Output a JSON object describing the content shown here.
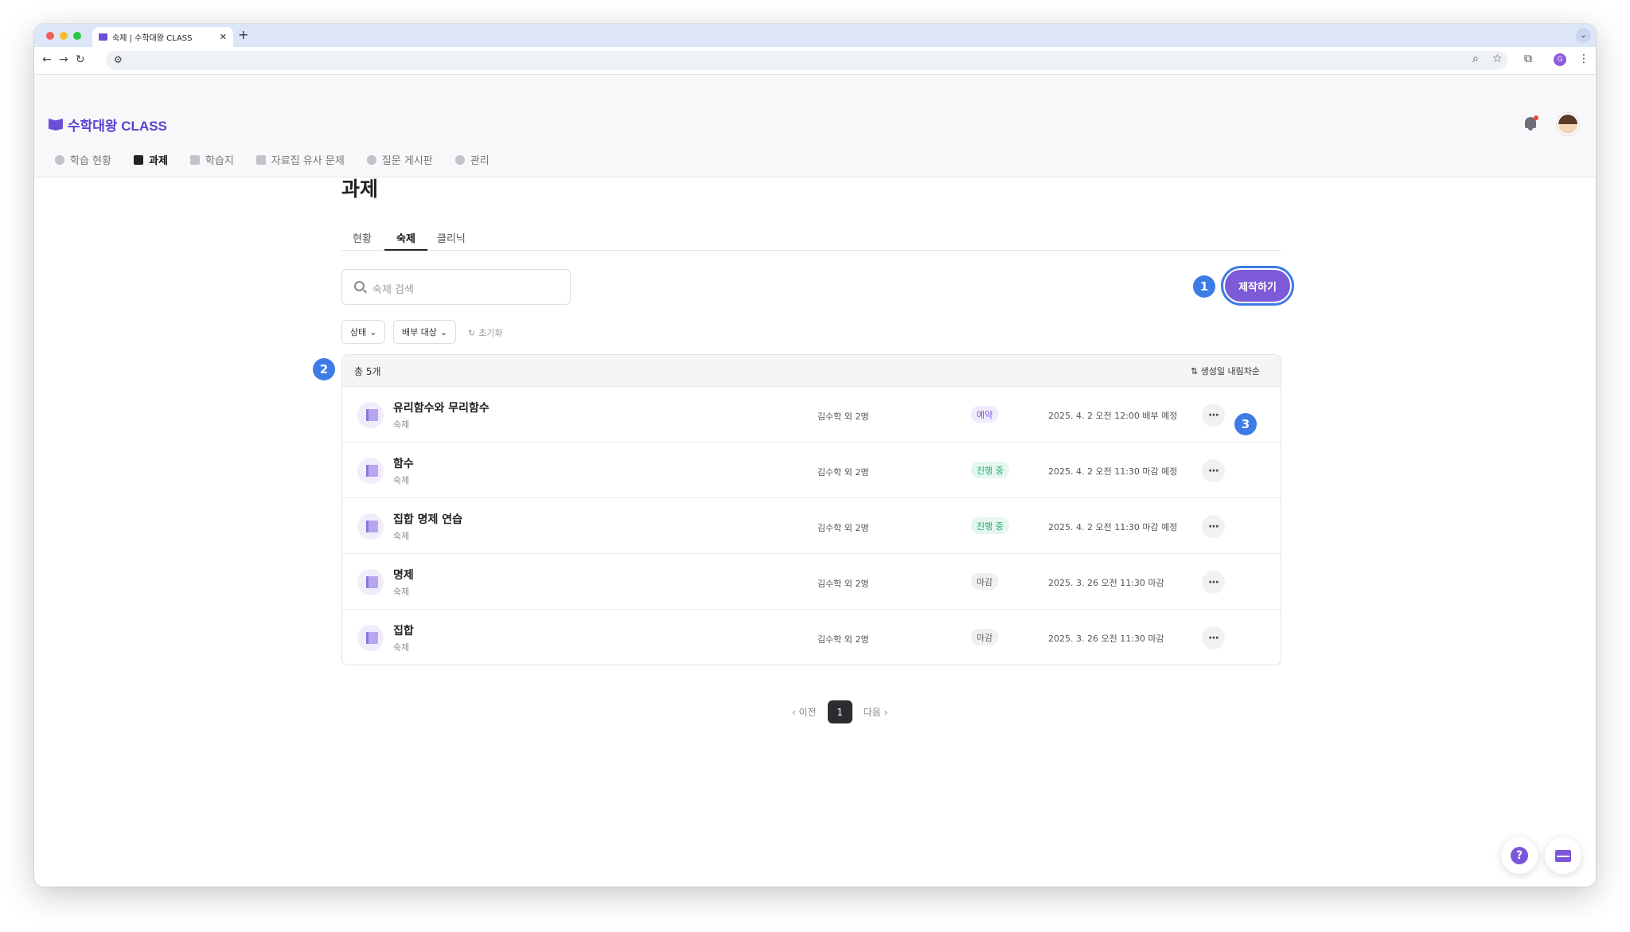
{
  "browser": {
    "tab_title": "숙제 | 수학대왕 CLASS",
    "new_tab": "+",
    "tab_close": "✕",
    "tab_menu": "⌄",
    "profile_initial": "G"
  },
  "app": {
    "logo": "수학대왕 CLASS",
    "nav": [
      {
        "label": "학습 현황"
      },
      {
        "label": "과제"
      },
      {
        "label": "학습지"
      },
      {
        "label": "자료집 유사 문제"
      },
      {
        "label": "질문 게시판"
      },
      {
        "label": "관리"
      }
    ],
    "active_nav": "과제"
  },
  "page": {
    "title": "과제",
    "tabs": [
      "현황",
      "숙제",
      "클리닉"
    ],
    "active_tab": "숙제",
    "search_placeholder": "숙제 검색",
    "create_button": "제작하기",
    "filters": {
      "status": "상태",
      "target": "배부 대상",
      "reset": "초기화"
    },
    "total": "총 5개",
    "sort": "생성일 내림차순",
    "annotations": [
      "1",
      "2",
      "3"
    ]
  },
  "rows": [
    {
      "title": "유리함수와 무리함수",
      "type": "숙제",
      "target": "김수학 외 2명",
      "status": "예약",
      "status_kind": "reserve",
      "date": "2025. 4. 2 오전 12:00 배부 예정"
    },
    {
      "title": "함수",
      "type": "숙제",
      "target": "김수학 외 2명",
      "status": "진행 중",
      "status_kind": "progress",
      "date": "2025. 4. 2 오전 11:30 마감 예정"
    },
    {
      "title": "집합 명제 연습",
      "type": "숙제",
      "target": "김수학 외 2명",
      "status": "진행 중",
      "status_kind": "progress",
      "date": "2025. 4. 2 오전 11:30 마감 예정"
    },
    {
      "title": "명제",
      "type": "숙제",
      "target": "김수학 외 2명",
      "status": "마감",
      "status_kind": "closed",
      "date": "2025. 3. 26 오전 11:30 마감"
    },
    {
      "title": "집합",
      "type": "숙제",
      "target": "김수학 외 2명",
      "status": "마감",
      "status_kind": "closed",
      "date": "2025. 3. 26 오전 11:30 마감"
    }
  ],
  "pagination": {
    "prev": "이전",
    "current": "1",
    "next": "다음"
  },
  "floating": {
    "help": "?"
  },
  "colors": {
    "brand": "#5b3fd0",
    "accent": "#7d5ad8",
    "annotation": "#3d7be6"
  }
}
